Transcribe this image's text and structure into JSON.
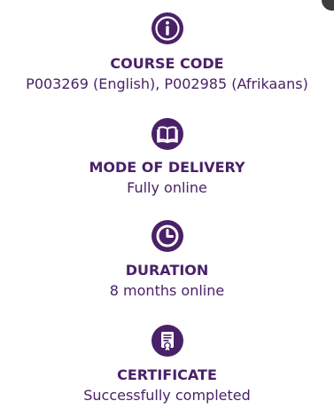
{
  "colors": {
    "accent": "#4a2168",
    "text": "#4a2168"
  },
  "items": [
    {
      "icon": "info-icon",
      "label": "COURSE CODE",
      "value": "P003269 (English), P002985 (Afrikaans)"
    },
    {
      "icon": "book-icon",
      "label": "MODE OF DELIVERY",
      "value": "Fully online"
    },
    {
      "icon": "clock-icon",
      "label": "DURATION",
      "value": "8 months online"
    },
    {
      "icon": "certificate-icon",
      "label": "CERTIFICATE",
      "value": "Successfully completed"
    }
  ]
}
